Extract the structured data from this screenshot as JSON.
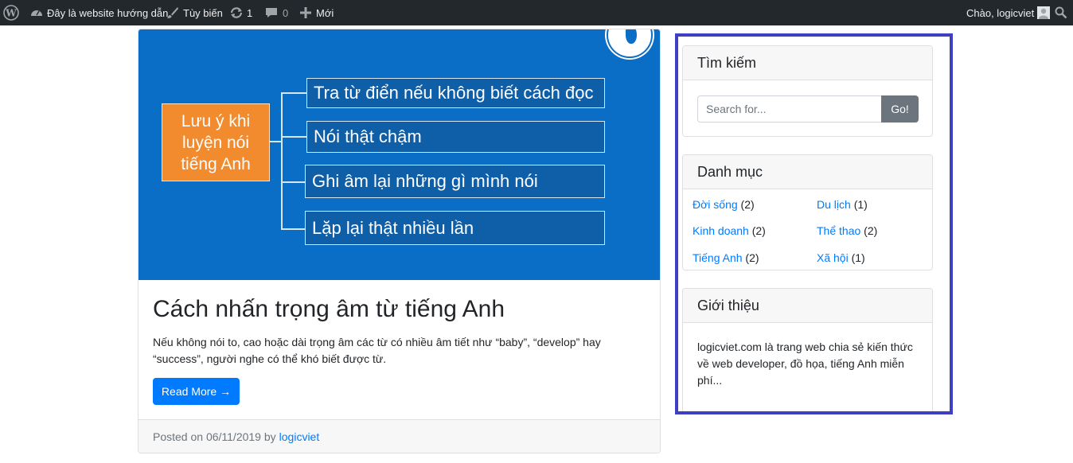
{
  "adminbar": {
    "site_name": "Đây là website hướng dẫn",
    "customize": "Tùy biến",
    "updates_count": "1",
    "comments_count": "0",
    "new_label": "Mới",
    "greeting": "Chào, logicviet",
    "bg_color": "#23282d"
  },
  "post": {
    "image_text": {
      "main": "Lưu ý khi luyện nói tiếng Anh",
      "boxes": [
        "Tra từ điển nếu không biết cách đọc",
        "Nói thật chậm",
        "Ghi âm lại những gì mình nói",
        "Lặp lại thật nhiều lần"
      ]
    },
    "title": "Cách nhấn trọng âm từ tiếng Anh",
    "excerpt": "Nếu không nói to, cao hoặc dài trọng âm các từ có nhiều âm tiết như “baby”, “develop” hay “success”, người nghe có thể khó biết được từ.",
    "read_more": "Read More →",
    "posted_on": "Posted on 06/11/2019 by",
    "author": "logicviet"
  },
  "sidebar": {
    "search": {
      "title": "Tìm kiếm",
      "placeholder": "Search for...",
      "button": "Go!"
    },
    "categories": {
      "title": "Danh mục",
      "items": [
        {
          "name": "Đời sống",
          "count": "(2)"
        },
        {
          "name": "Du lịch",
          "count": "(1)"
        },
        {
          "name": "Kinh doanh",
          "count": "(2)"
        },
        {
          "name": "Thể thao",
          "count": "(2)"
        },
        {
          "name": "Tiếng Anh",
          "count": "(2)"
        },
        {
          "name": "Xã hội",
          "count": "(1)"
        }
      ]
    },
    "about": {
      "title": "Giới thiệu",
      "text": "logicviet.com là trang web chia sẻ kiến thức về web developer, đồ họa, tiếng Anh miễn phí..."
    }
  },
  "colors": {
    "accent": "#007bff",
    "highlight_frame": "#3f3fc4",
    "hero_bg": "#0a6dc6",
    "orange": "#f28a2e"
  }
}
